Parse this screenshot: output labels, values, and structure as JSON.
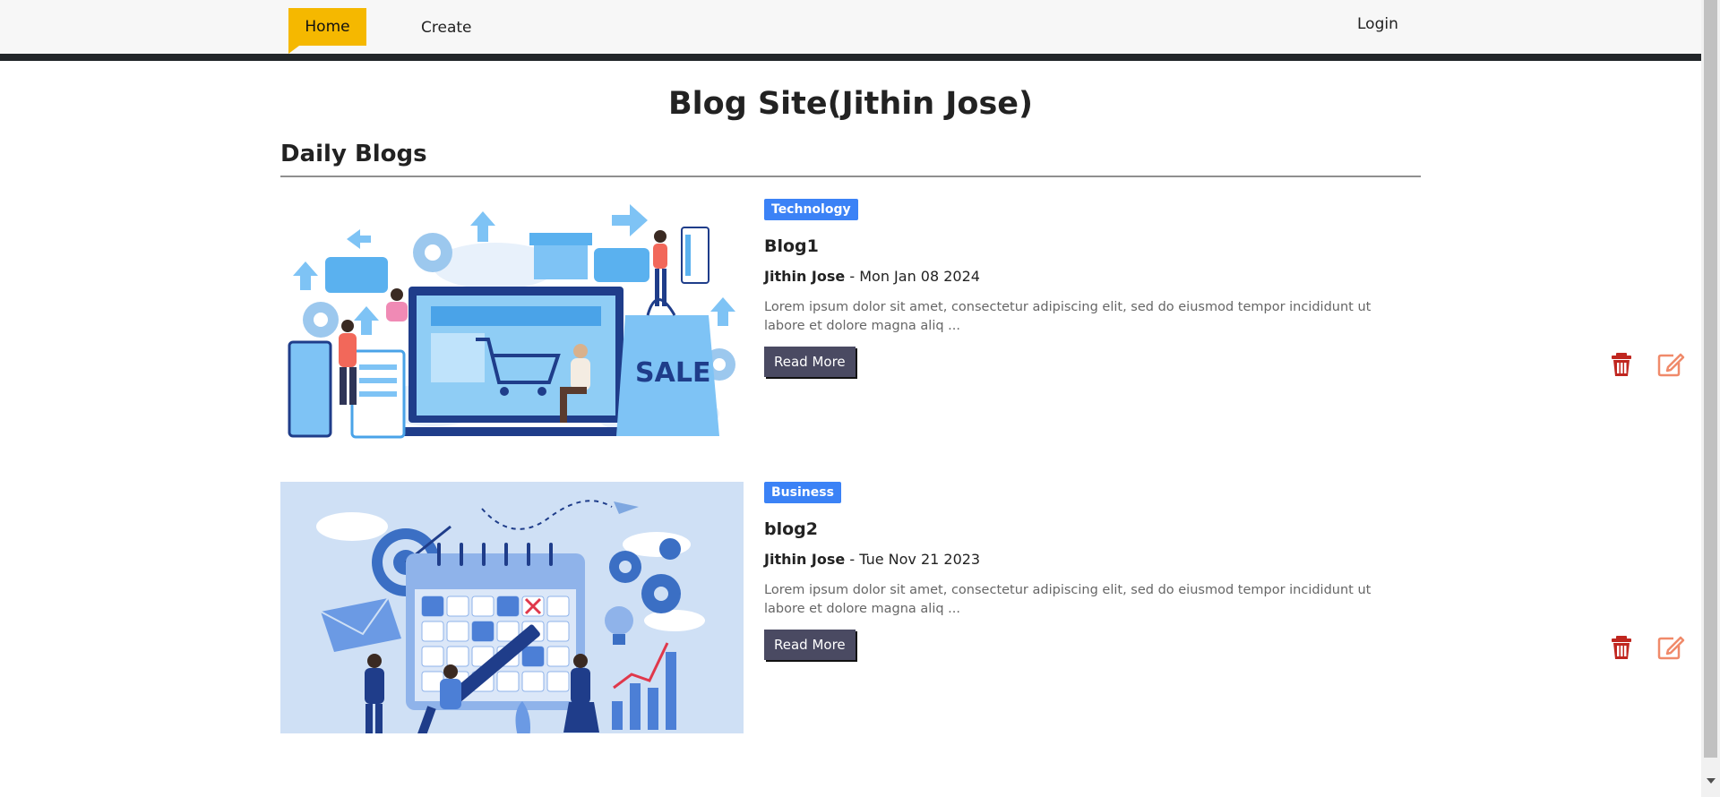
{
  "nav": {
    "home": "Home",
    "create": "Create",
    "login": "Login"
  },
  "page": {
    "title": "Blog Site(Jithin Jose)",
    "section": "Daily Blogs"
  },
  "posts": [
    {
      "category": "Technology",
      "title": "Blog1",
      "author": "Jithin Jose",
      "separator": "-",
      "date": "Mon Jan 08 2024",
      "excerpt": "Lorem ipsum dolor sit amet, consectetur adipiscing elit, sed do eiusmod tempor incididunt ut labore et dolore magna aliq ...",
      "read_more": "Read More",
      "image_text": "SALE"
    },
    {
      "category": "Business",
      "title": "blog2",
      "author": "Jithin Jose",
      "separator": "-",
      "date": "Tue Nov 21 2023",
      "excerpt": "Lorem ipsum dolor sit amet, consectetur adipiscing elit, sed do eiusmod tempor incididunt ut labore et dolore magna aliq ...",
      "read_more": "Read More"
    }
  ],
  "colors": {
    "nav_active": "#f5b800",
    "badge": "#3b82f6",
    "button": "#4a4a62",
    "delete_icon": "#c0261f",
    "edit_icon": "#f08a6a"
  },
  "icons": {
    "delete": "trash-icon",
    "edit": "edit-icon"
  }
}
